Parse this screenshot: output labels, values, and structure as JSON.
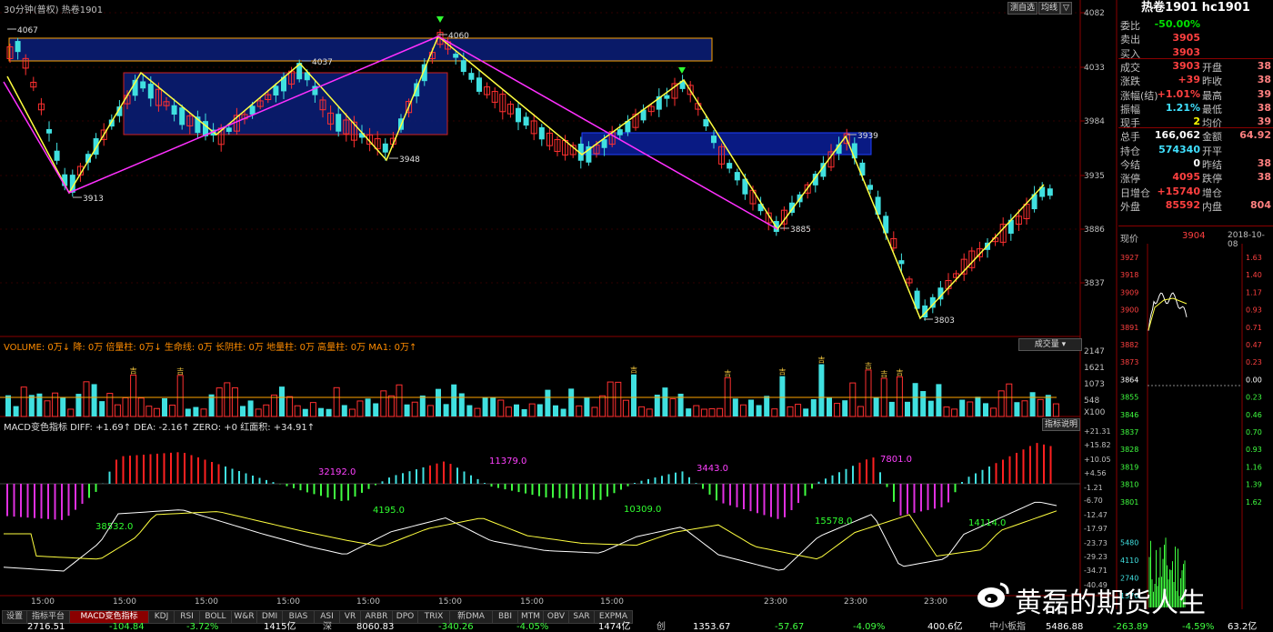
{
  "chart_title": "30分钟(普权)  热卷1901",
  "corner_buttons": [
    "测自选",
    "均线",
    "▽"
  ],
  "price_axis": [
    "4082",
    "4033",
    "3984",
    "3935",
    "3886",
    "3837"
  ],
  "price_annotations": [
    "4067",
    "4060",
    "4037",
    "3913",
    "3948",
    "3939",
    "3885",
    "3803"
  ],
  "volume_title": "VOLUME: 0万↓ 降: 0万 倍量柱: 0万↓ 生命线: 0万 长阴柱: 0万 地量柱: 0万 高量柱: 0万 MA1: 0万↑",
  "volume_selector": "成交量",
  "volume_axis": [
    "2147",
    "1621",
    "1073",
    "548",
    "X100"
  ],
  "volume_marker": "吉",
  "macd_title": "MACD变色指标  DIFF: +1.69↑  DEA: -2.16↑  ZERO: +0  红面积: +34.91↑",
  "macd_button": "指标说明",
  "macd_axis": [
    "+21.31",
    "+15.82",
    "+10.05",
    "+4.56",
    "-1.21",
    "-6.70",
    "-12.47",
    "-17.97",
    "-23.73",
    "-29.23",
    "-34.71",
    "-40.49"
  ],
  "macd_areas": [
    "38532.0",
    "32192.0",
    "4195.0",
    "11379.0",
    "10309.0",
    "3443.0",
    "15578.0",
    "7801.0",
    "14114.0"
  ],
  "time_axis": [
    "15:00",
    "15:00",
    "15:00",
    "15:00",
    "15:00",
    "15:00",
    "15:00",
    "15:00",
    "23:00",
    "23:00",
    "23:00"
  ],
  "tabs": [
    "设置",
    "指标平台",
    "MACD变色指标",
    "KDJ",
    "RSI",
    "BOLL",
    "W&R",
    "DMI",
    "BIAS",
    "ASI",
    "VR",
    "ARBR",
    "DPO",
    "TRIX",
    "新DMA",
    "BBI",
    "MTM",
    "OBV",
    "SAR",
    "EXPMA"
  ],
  "status_bar": [
    "2716.51",
    "-104.84",
    "-3.72%",
    "1415亿",
    "深",
    "8060.83",
    "-340.26",
    "-4.05%",
    "1474亿",
    "创",
    "1353.67",
    "-57.67",
    "-4.09%",
    "400.6亿",
    "中小板指",
    "5486.88",
    "-263.89",
    "-4.59%",
    "63.2亿"
  ],
  "quote": {
    "title": "热卷1901 hc1901",
    "rows": [
      {
        "label": "委比",
        "value": "-50.00%",
        "label2": "",
        "value2": "",
        "color": "#00e000"
      },
      {
        "label": "卖出",
        "value": "3905",
        "label2": "",
        "value2": "",
        "color": "#ff4040"
      },
      {
        "label": "买入",
        "value": "3903",
        "label2": "",
        "value2": "",
        "color": "#ff4040"
      },
      {
        "label": "成交",
        "value": "3903",
        "label2": "开盘",
        "value2": "38",
        "color": "#ff4040"
      },
      {
        "label": "涨跌",
        "value": "+39",
        "label2": "昨收",
        "value2": "38",
        "color": "#ff4040"
      },
      {
        "label": "涨幅(结)",
        "value": "+1.01%",
        "label2": "最高",
        "value2": "39",
        "color": "#ff4040"
      },
      {
        "label": "振幅",
        "value": "1.21%",
        "label2": "最低",
        "value2": "38",
        "color": "#40e0ff"
      },
      {
        "label": "现手",
        "value": "2",
        "label2": "均价",
        "value2": "39",
        "color": "#ffff00"
      },
      {
        "label": "总手",
        "value": "166,062",
        "label2": "金额",
        "value2": "64.92",
        "color": "#ffffff"
      },
      {
        "label": "持仓",
        "value": "574340",
        "label2": "开平",
        "value2": "",
        "color": "#40e0ff"
      },
      {
        "label": "今结",
        "value": "0",
        "label2": "昨结",
        "value2": "38",
        "color": "#ffffff"
      },
      {
        "label": "涨停",
        "value": "4095",
        "label2": "跌停",
        "value2": "38",
        "color": "#ff4040"
      },
      {
        "label": "日增仓",
        "value": "+15740",
        "label2": "增仓",
        "value2": "",
        "color": "#ff4040"
      },
      {
        "label": "外盘",
        "value": "85592",
        "label2": "内盘",
        "value2": "804",
        "color": "#ff4040"
      }
    ],
    "tick_label": "现价",
    "tick_price": "3904",
    "tick_date": "2018-10-08",
    "mini_left_axis": [
      "3927",
      "3918",
      "3909",
      "3900",
      "3891",
      "3882",
      "3873",
      "3864",
      "3855",
      "3846",
      "3837",
      "3828",
      "3819",
      "3810",
      "3801",
      "5480",
      "4110",
      "2740",
      "1370"
    ],
    "mini_right_axis": [
      "1.63",
      "1.40",
      "1.17",
      "0.93",
      "0.71",
      "0.47",
      "0.23",
      "0.00",
      "0.23",
      "0.46",
      "0.70",
      "0.93",
      "1.16",
      "1.39",
      "1.62"
    ]
  },
  "watermark": "黄磊的期货人生"
}
